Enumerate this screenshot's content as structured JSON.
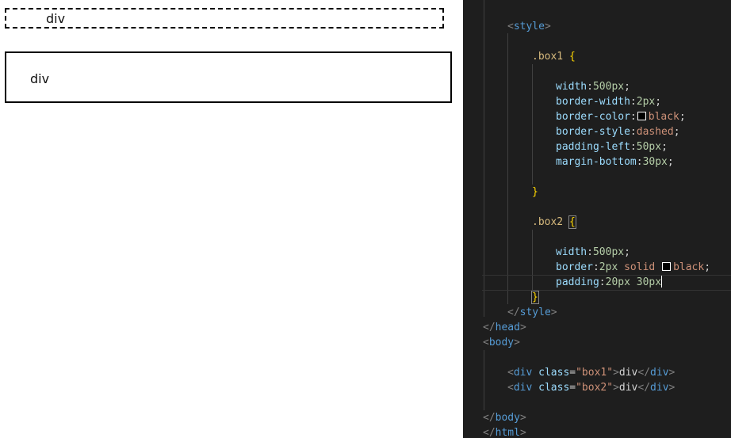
{
  "preview": {
    "box1_text": "div",
    "box2_text": "div"
  },
  "code": {
    "style_open_tag": "style",
    "box1_selector": ".box1",
    "box1_rules": [
      {
        "prop": "width",
        "value": "500px"
      },
      {
        "prop": "border-width",
        "value": "2px"
      },
      {
        "prop": "border-color",
        "value": "black"
      },
      {
        "prop": "border-style",
        "value": "dashed"
      },
      {
        "prop": "padding-left",
        "value": "50px"
      },
      {
        "prop": "margin-bottom",
        "value": "30px"
      }
    ],
    "box2_selector": ".box2",
    "box2_rules": [
      {
        "prop": "width",
        "value": "500px"
      },
      {
        "prop": "border",
        "value_num": "2px",
        "value_kw": "solid",
        "value_color": "black"
      },
      {
        "prop": "padding",
        "value": "20px 30px"
      }
    ],
    "style_close_tag": "style",
    "head_close_tag": "head",
    "body_open_tag": "body",
    "div1": {
      "tag": "div",
      "attr": "class",
      "value": "\"box1\"",
      "text": "div"
    },
    "div2": {
      "tag": "div",
      "attr": "class",
      "value": "\"box2\"",
      "text": "div"
    },
    "body_close_tag": "body",
    "html_close_tag": "html"
  },
  "colors": {
    "editor_bg": "#1e1e1e",
    "tag": "#569cd6",
    "selector": "#d7ba7d",
    "property": "#9cdcfe",
    "number": "#b5cea8",
    "keyword": "#ce9178"
  }
}
